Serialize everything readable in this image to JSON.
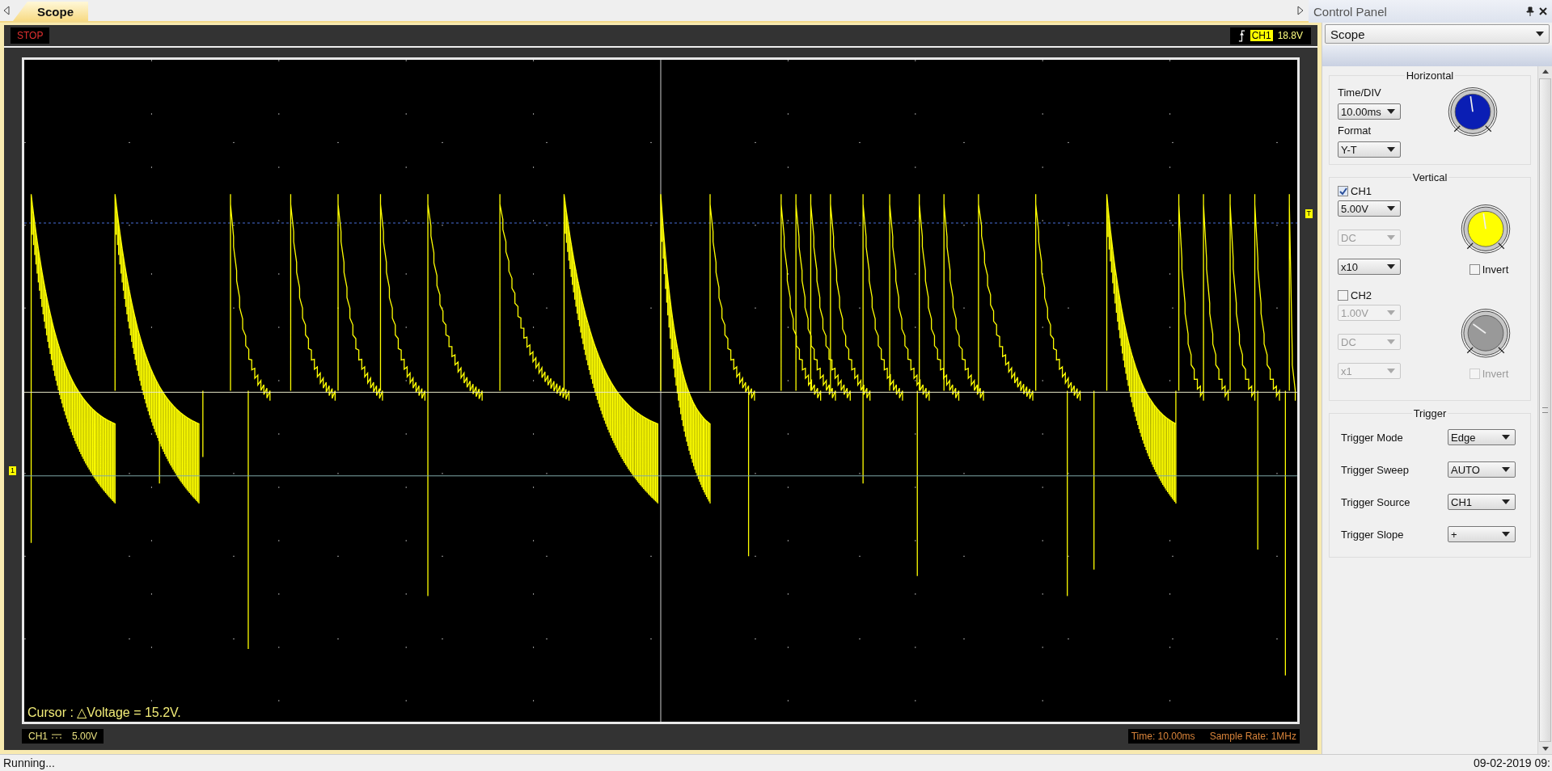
{
  "tabs": [
    {
      "label": "Scope",
      "selected": true
    }
  ],
  "scope": {
    "run_state": "STOP",
    "trigger_badge": {
      "channel": "CH1",
      "level_text": "18.8V"
    },
    "channel_marker": "1",
    "trigger_marker": "T",
    "cursor_readout": "Cursor : △Voltage = 15.2V.",
    "channel_readout": {
      "channel": "CH1",
      "scale": "5.00V"
    },
    "time_readout": "Time: 10.00ms",
    "sample_rate": "Sample Rate: 1MHz"
  },
  "control_panel": {
    "title": "Control Panel",
    "mode": "Scope",
    "horizontal": {
      "title": "Horizontal",
      "time_label": "Time/DIV",
      "time_value": "10.00ms",
      "format_label": "Format",
      "format_value": "Y-T"
    },
    "vertical": {
      "title": "Vertical",
      "channels": [
        {
          "label": "CH1",
          "checked": true,
          "color": "#ffff00",
          "dropdowns": [
            {
              "value": "5.00V",
              "disabled": false
            },
            {
              "value": "DC",
              "disabled": true
            },
            {
              "value": "x10",
              "disabled": false
            }
          ],
          "invert_label": "Invert",
          "invert": false,
          "invert_disabled": false
        },
        {
          "label": "CH2",
          "checked": false,
          "color": "#999999",
          "dropdowns": [
            {
              "value": "1.00V",
              "disabled": true
            },
            {
              "value": "DC",
              "disabled": true
            },
            {
              "value": "x1",
              "disabled": true
            }
          ],
          "invert_label": "Invert",
          "invert": false,
          "invert_disabled": true
        }
      ]
    },
    "trigger": {
      "title": "Trigger",
      "rows": [
        {
          "label": "Trigger Mode",
          "value": "Edge"
        },
        {
          "label": "Trigger Sweep",
          "value": "AUTO"
        },
        {
          "label": "Trigger Source",
          "value": "CH1"
        },
        {
          "label": "Trigger Slope",
          "value": "+"
        }
      ]
    }
  },
  "status_bar": {
    "message": "Running...",
    "datetime": "09-02-2019 09:"
  }
}
